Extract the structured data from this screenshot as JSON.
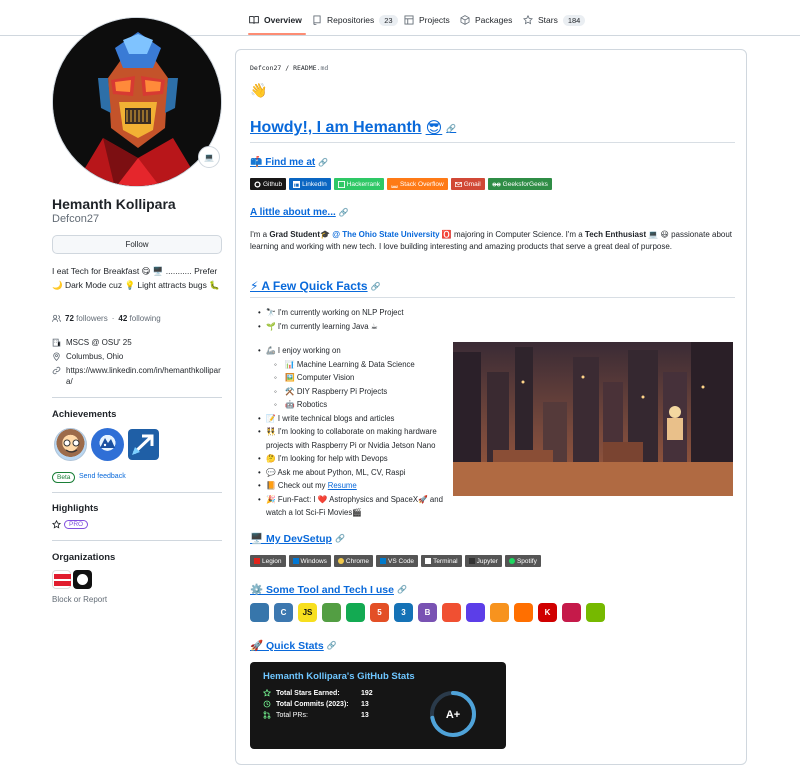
{
  "nav": {
    "tabs": [
      {
        "label": "Overview"
      },
      {
        "label": "Repositories",
        "count": "23"
      },
      {
        "label": "Projects"
      },
      {
        "label": "Packages"
      },
      {
        "label": "Stars",
        "count": "184"
      }
    ]
  },
  "profile": {
    "status_emoji": "💻",
    "name": "Hemanth Kollipara",
    "username": "Defcon27",
    "follow_label": "Follow",
    "bio": "I eat Tech for Breakfast 😋 🖥️ ........... Prefer 🌙 Dark Mode cuz 💡 Light attracts bugs 🐛",
    "followers_count": "72",
    "followers_label": "followers",
    "separator": "·",
    "following_count": "42",
    "following_label": "following",
    "organization": "MSCS @ OSU' 25",
    "location": "Columbus, Ohio",
    "website": "https://www.linkedin.com/in/hemanthkollipara/"
  },
  "achievements": {
    "title": "Achievements",
    "beta_label": "Beta",
    "feedback_label": "Send feedback"
  },
  "highlights": {
    "title": "Highlights",
    "pro_label": "PRO"
  },
  "organizations": {
    "title": "Organizations",
    "block_label": "Block or Report"
  },
  "readme": {
    "path_user": "Defcon27",
    "path_sep": " / ",
    "path_file": "README",
    "path_ext": ".md",
    "wave": "👋",
    "heading": "Howdy!, I am Hemanth",
    "heading_emoji": "😎",
    "find_me_heading": "📫 Find me at",
    "shields": [
      {
        "label": "Github",
        "color": "#181717"
      },
      {
        "label": "LinkedIn",
        "color": "#0A66C2"
      },
      {
        "label": "Hackerrank",
        "color": "#2EC866"
      },
      {
        "label": "Stack Overflow",
        "color": "#FE7A16"
      },
      {
        "label": "Gmail",
        "color": "#D14836"
      },
      {
        "label": "GeeksforGeeks",
        "color": "#2F8D46"
      }
    ],
    "about_heading": "A little about me...",
    "about": {
      "p1": "I'm a ",
      "b1": "Grad Student🎓",
      "p2": " ",
      "link": "@ The Ohio State University",
      "p3": " 🅾️ majoring in Computer Science. I'm a ",
      "b2": "Tech Enthusiast",
      "p4": " 💻 😃 passionate about learning and working with new tech. I love building interesting and amazing products that serve a great deal of purpose."
    },
    "facts_heading": "⚡ A Few Quick Facts",
    "facts": [
      "🔭 I'm currently working on NLP Project",
      "🌱 I'm currently learning Java ☕"
    ],
    "enjoy": "🦾 I enjoy working on",
    "enjoy_items": [
      "📊 Machine Learning & Data Science",
      "🖼️ Computer Vision",
      "⚒️ DIY Raspberry Pi Projects",
      "🤖 Robotics"
    ],
    "facts2": [
      "📝 I write technical blogs and articles",
      "👯 I'm looking to collaborate on making hardware",
      "projects with Raspberry Pi or Nvidia Jetson Nano",
      "🤔 I'm looking for help with Devops",
      "💬 Ask me about Python, ML, CV, Raspi"
    ],
    "resume_prefix": "📙 Check out my ",
    "resume_link": "Resume",
    "funfact_1": "🎉 Fun-Fact: I ❤️ Astrophysics and SpaceX🚀 and",
    "funfact_2": "watch a lot Sci-Fi Movies🎬",
    "devsetup_heading": "🖥️ My DevSetup",
    "devsetup": [
      {
        "label": "Legion",
        "color": "#E2231A"
      },
      {
        "label": "Windows",
        "color": "#0078D6"
      },
      {
        "label": "Chrome",
        "color": "#4285F4"
      },
      {
        "label": "VS Code",
        "color": "#007ACC"
      },
      {
        "label": "Terminal",
        "color": "#4D4D4D"
      },
      {
        "label": "Jupyter",
        "color": "#F37626"
      },
      {
        "label": "Spotify",
        "color": "#1ED760"
      }
    ],
    "tools_heading": "⚙️ Some Tool and Tech I use",
    "tools": [
      {
        "name": "python-icon",
        "glyph": "",
        "color": "#3776AB"
      },
      {
        "name": "c-icon",
        "glyph": "C",
        "color": "#3d78b0"
      },
      {
        "name": "javascript-icon",
        "glyph": "JS",
        "color": "#F7DF1E"
      },
      {
        "name": "nodejs-icon",
        "glyph": "",
        "color": "#539E43"
      },
      {
        "name": "mongodb-icon",
        "glyph": "",
        "color": "#13aa52"
      },
      {
        "name": "html5-icon",
        "glyph": "5",
        "color": "#E34F26"
      },
      {
        "name": "css3-icon",
        "glyph": "3",
        "color": "#1572B6"
      },
      {
        "name": "bootstrap-icon",
        "glyph": "B",
        "color": "#7952B3"
      },
      {
        "name": "git-icon",
        "glyph": "",
        "color": "#F05032"
      },
      {
        "name": "opencv-icon",
        "glyph": "",
        "color": "#5C3EE8"
      },
      {
        "name": "scikit-learn-icon",
        "glyph": "",
        "color": "#F7931E"
      },
      {
        "name": "tensorflow-icon",
        "glyph": "",
        "color": "#FF6F00"
      },
      {
        "name": "keras-icon",
        "glyph": "K",
        "color": "#D00000"
      },
      {
        "name": "raspberry-pi-icon",
        "glyph": "",
        "color": "#C51A4A"
      },
      {
        "name": "nvidia-icon",
        "glyph": "",
        "color": "#76B900"
      }
    ],
    "stats_heading": "🚀 Quick Stats",
    "stats": {
      "title": "Hemanth Kollipara's GitHub Stats",
      "rows": [
        {
          "label": "Total Stars Earned:",
          "value": "192"
        },
        {
          "label": "Total Commits (2023):",
          "value": "13"
        },
        {
          "label": "Total PRs:",
          "value": "13"
        }
      ],
      "grade": "A+",
      "grade_progress": 0.72
    }
  }
}
